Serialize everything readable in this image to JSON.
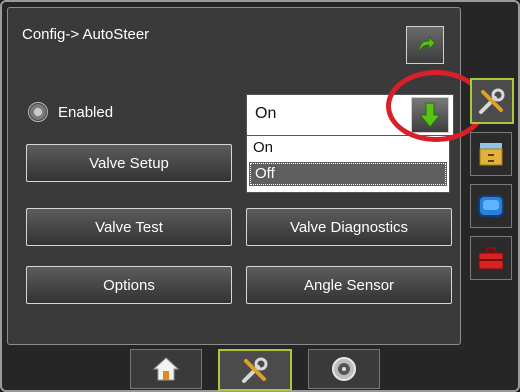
{
  "header": {
    "title": "Config-> AutoSteer"
  },
  "toolbar": {
    "back_icon": "green-return-arrow-icon"
  },
  "enabled": {
    "label": "Enabled",
    "icon": "steering-wheel-icon",
    "selected": "On",
    "options": [
      "On",
      "Off"
    ],
    "highlighted_option": "Off",
    "arrow_icon": "green-down-arrow-icon"
  },
  "buttons": {
    "valve_setup": "Valve Setup",
    "valve_test": "Valve Test",
    "valve_diagnostics": "Valve Diagnostics",
    "options": "Options",
    "angle_sensor": "Angle Sensor"
  },
  "side_tabs": [
    {
      "icon": "tools-icon",
      "active": true
    },
    {
      "icon": "file-cabinet-icon",
      "active": false
    },
    {
      "icon": "console-display-icon",
      "active": false
    },
    {
      "icon": "toolbox-icon",
      "active": false
    }
  ],
  "bottom_tabs": [
    {
      "icon": "home-icon",
      "active": false
    },
    {
      "icon": "tools-icon",
      "active": true
    },
    {
      "icon": "gauge-icon",
      "active": false
    }
  ],
  "colors": {
    "accent_green": "#a7c93b",
    "highlight_red": "#d8202a",
    "arrow_green": "#58c41a"
  }
}
